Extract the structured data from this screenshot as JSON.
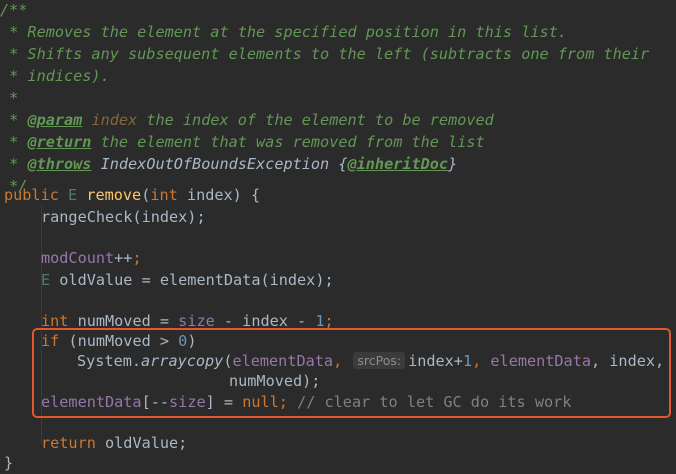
{
  "doc": {
    "open": "/**",
    "line1": " * Removes the element at the specified position in this list.",
    "line2": " * Shifts any subsequent elements to the left (subtracts one from their",
    "line3": " * indices).",
    "line4": " *",
    "star": " * ",
    "param_tag": "@param",
    "param_name": "index",
    "param_desc": " the index of the element to be removed",
    "return_tag": "@return",
    "return_desc": " the element that was removed from the list",
    "throws_tag": "@throws",
    "throws_type": "IndexOutOfBoundsException",
    "throws_open": " {",
    "inherit_tag": "@inheritDoc",
    "throws_close": "}",
    "close": " */"
  },
  "code": {
    "kw_public": "public",
    "type_E": "E",
    "method_name": "remove",
    "lparen": "(",
    "kw_int": "int",
    "sig_rest": " index) {",
    "range_check": "rangeCheck(index);",
    "mod_count": "modCount",
    "mod_incr": "++",
    "semicolon": ";",
    "old_value_rest": " oldValue = elementData(index);",
    "num_moved_eq": " numMoved = ",
    "size": "size",
    "minus_index_minus": " - index - ",
    "one": "1",
    "kw_if": "if",
    "if_mid": " (numMoved > ",
    "zero": "0",
    "rparen": ")",
    "system": "System.",
    "arraycopy": "arraycopy",
    "element_data": "elementData",
    "comma_space": ", ",
    "hint_srcpos": "srcPos:",
    "index_plus": "index+",
    "index_comma": ", index,",
    "num_moved_arg": "numMoved);",
    "bracket_dec": "[--",
    "assign_rest": "] = ",
    "kw_null": "null",
    "comment_gc": "// clear to let GC do its work",
    "kw_return": "return",
    "return_rest": " oldValue;",
    "close_brace": "}"
  },
  "colors": {
    "background": "#2b2b2b",
    "default_text": "#a9b7c6",
    "javadoc": "#629755",
    "keyword": "#cc7832",
    "method": "#ffc66d",
    "field": "#9876aa",
    "number": "#6897bb",
    "comment": "#808080",
    "highlight_border": "#e2572d"
  }
}
